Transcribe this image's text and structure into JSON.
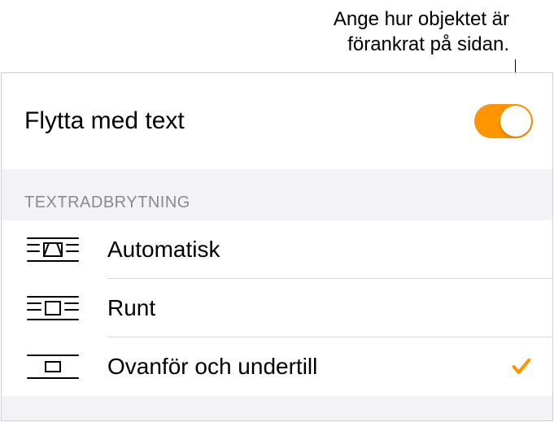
{
  "callout": {
    "line1": "Ange hur objektet är",
    "line2": "förankrat på sidan."
  },
  "toggle": {
    "label": "Flytta med text",
    "on": true
  },
  "section": {
    "header": "TEXTRADBRYTNING"
  },
  "wrap_options": [
    {
      "label": "Automatisk",
      "selected": false,
      "icon": "wrap-auto"
    },
    {
      "label": "Runt",
      "selected": false,
      "icon": "wrap-around"
    },
    {
      "label": "Ovanför och undertill",
      "selected": true,
      "icon": "wrap-above-below"
    }
  ]
}
